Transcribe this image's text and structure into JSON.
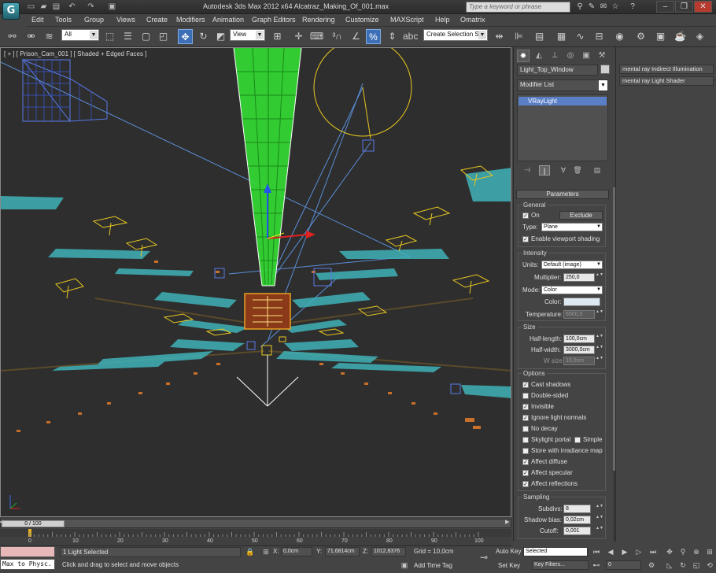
{
  "app": {
    "logo_text": "G",
    "title": "Autodesk 3ds Max  2012 x64      Alcatraz_Making_Of_001.max",
    "search_placeholder": "Type a keyword or phrase",
    "minimize": "–",
    "restore": "❐",
    "close": "✕"
  },
  "menu": [
    "Edit",
    "Tools",
    "Group",
    "Views",
    "Create",
    "Modifiers",
    "Animation",
    "Graph Editors",
    "Rendering",
    "Customize",
    "MAXScript",
    "Help",
    "Omatrix"
  ],
  "toolbar": {
    "selection_filter": "All",
    "reference_coord": "View",
    "named_selection": "Create Selection Se"
  },
  "viewport": {
    "label": "[ + ] [ Prison_Cam_001 ] [ Shaded + Edged Faces ]"
  },
  "command_panel": {
    "object_name": "Light_Top_Window",
    "modifier_list": "Modifier List",
    "stack_item": "VRayLight",
    "rollout_title": "Parameters",
    "general": {
      "label": "General",
      "on_label": "On",
      "exclude_label": "Exclude",
      "type_label": "Type:",
      "type_value": "Plane",
      "viewport_shading_label": "Enable viewport shading"
    },
    "intensity": {
      "label": "Intensity",
      "units_label": "Units:",
      "units_value": "Default (image)",
      "multiplier_label": "Multiplier:",
      "multiplier_value": "250,0",
      "mode_label": "Mode:",
      "mode_value": "Color",
      "color_label": "Color:",
      "color_hex": "#dde8f0",
      "temperature_label": "Temperature:",
      "temperature_value": "6500,0"
    },
    "size": {
      "label": "Size",
      "half_length_label": "Half-length:",
      "half_length_value": "100,0cm",
      "half_width_label": "Half-width:",
      "half_width_value": "3000,0cm",
      "w_size_label": "W size",
      "w_size_value": "10,0cm"
    },
    "options": {
      "label": "Options",
      "items": [
        {
          "label": "Cast shadows",
          "checked": true
        },
        {
          "label": "Double-sided",
          "checked": false
        },
        {
          "label": "Invisible",
          "checked": true
        },
        {
          "label": "Ignore light normals",
          "checked": true
        },
        {
          "label": "No decay",
          "checked": false
        },
        {
          "label": "Skylight portal",
          "checked": false
        },
        {
          "label": "Store with irradiance map",
          "checked": false
        },
        {
          "label": "Affect diffuse",
          "checked": true
        },
        {
          "label": "Affect specular",
          "checked": true
        },
        {
          "label": "Affect reflections",
          "checked": true
        }
      ],
      "simple_label": "Simple"
    },
    "sampling": {
      "label": "Sampling",
      "subdivs_label": "Subdivs:",
      "subdivs_value": "8",
      "shadow_bias_label": "Shadow bias:",
      "shadow_bias_value": "0,02cm",
      "cutoff_label": "Cutoff:",
      "cutoff_value": "0,001"
    }
  },
  "right_panel": {
    "items": [
      "mental ray Indirect Illumination",
      "mental ray Light Shader"
    ]
  },
  "timeline": {
    "slider_label": "0 / 100",
    "ticks": [
      "0",
      "10",
      "20",
      "30",
      "40",
      "50",
      "60",
      "70",
      "80",
      "90",
      "100"
    ]
  },
  "status": {
    "maxscript_text": "Max to Physc.",
    "selection": "1 Light Selected",
    "prompt": "Click and drag to select and move objects",
    "x_label": "X:",
    "x_value": "0,0cm",
    "y_label": "Y:",
    "y_value": "71,6814cm",
    "z_label": "Z:",
    "z_value": "1012,8376",
    "grid": "Grid = 10,0cm",
    "add_time_tag": "Add Time Tag",
    "auto_key": "Auto Key",
    "set_key": "Set Key",
    "key_mode": "Selected",
    "key_filters": "Key Filters...",
    "frame": "0"
  }
}
